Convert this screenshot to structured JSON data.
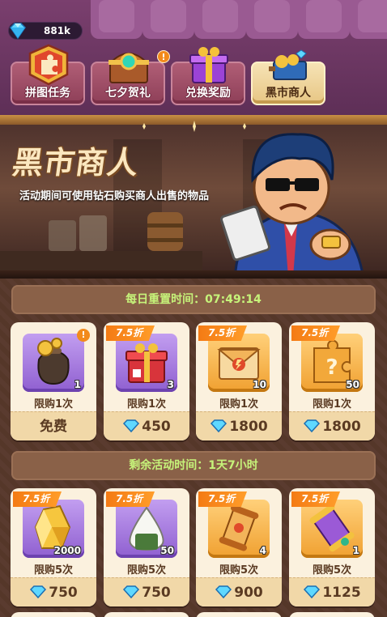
{
  "currency": {
    "amount": "881k",
    "icon": "diamond-icon"
  },
  "tabs": [
    {
      "label": "拼图任务",
      "icon": "puzzle-icon",
      "active": false,
      "alert": ""
    },
    {
      "label": "七夕贺礼",
      "icon": "treasure-chest-icon",
      "active": false,
      "alert": "!"
    },
    {
      "label": "兑换奖励",
      "icon": "gift-box-icon",
      "active": false,
      "alert": ""
    },
    {
      "label": "黑市商人",
      "icon": "merchant-cart-icon",
      "active": true,
      "alert": ""
    }
  ],
  "banner": {
    "title": "黑市商人",
    "description": "活动期间可使用钻石购买商人出售的物品"
  },
  "daily_section": {
    "label": "每日重置时间：07:49:14"
  },
  "event_section": {
    "label": "剩余活动时间：1天7小时"
  },
  "daily_items": [
    {
      "name": "coin-bag",
      "qty": "1",
      "discount": "",
      "limit": "限购1次",
      "price": "免费",
      "free": true,
      "alert": "!"
    },
    {
      "name": "red-gift-box",
      "qty": "3",
      "discount": "7.5折",
      "limit": "限购1次",
      "price": "450",
      "free": false,
      "alert": ""
    },
    {
      "name": "envelope",
      "qty": "10",
      "discount": "7.5折",
      "limit": "限购1次",
      "price": "1800",
      "free": false,
      "alert": ""
    },
    {
      "name": "mystery-puzzle",
      "qty": "50",
      "discount": "7.5折",
      "limit": "限购1次",
      "price": "1800",
      "free": false,
      "alert": ""
    }
  ],
  "event_items": [
    {
      "name": "gold-crystal",
      "qty": "2000",
      "discount": "7.5折",
      "limit": "限购5次",
      "price": "750"
    },
    {
      "name": "rice-ball",
      "qty": "50",
      "discount": "7.5折",
      "limit": "限购5次",
      "price": "750"
    },
    {
      "name": "scroll",
      "qty": "4",
      "discount": "7.5折",
      "limit": "限购5次",
      "price": "900"
    },
    {
      "name": "purple-scroll",
      "qty": "1",
      "discount": "7.5折",
      "limit": "限购5次",
      "price": "1125"
    }
  ],
  "colors": {
    "accent_green": "#c6f37a",
    "discount_orange": "#f47b14",
    "card_bg": "#fbf1de"
  }
}
